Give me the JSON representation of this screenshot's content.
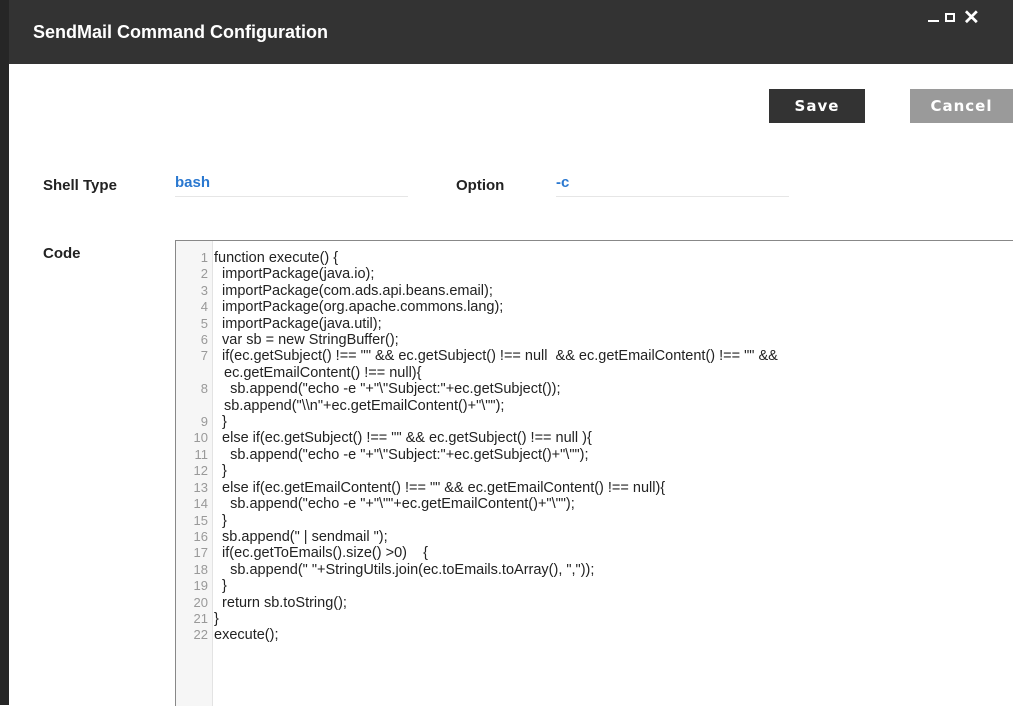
{
  "window": {
    "title": "SendMail Command Configuration"
  },
  "buttons": {
    "save": "Save",
    "cancel": "Cancel"
  },
  "form": {
    "shell_type_label": "Shell Type",
    "shell_type_value": "bash",
    "option_label": "Option",
    "option_value": "-c",
    "code_label": "Code"
  },
  "code": [
    {
      "n": "1",
      "t": "function execute() {"
    },
    {
      "n": "2",
      "t": "  importPackage(java.io);"
    },
    {
      "n": "3",
      "t": "  importPackage(com.ads.api.beans.email);"
    },
    {
      "n": "4",
      "t": "  importPackage(org.apache.commons.lang);"
    },
    {
      "n": "5",
      "t": "  importPackage(java.util);"
    },
    {
      "n": "6",
      "t": "  var sb = new StringBuffer();"
    },
    {
      "n": "7",
      "t": "  if(ec.getSubject() !== \"\" && ec.getSubject() !== null  && ec.getEmailContent() !== \"\" &&"
    },
    {
      "n": "",
      "t": "ec.getEmailContent() !== null){"
    },
    {
      "n": "8",
      "t": "    sb.append(\"echo -e \"+\"\\\"Subject:\"+ec.getSubject());"
    },
    {
      "n": "",
      "t": "sb.append(\"\\\\n\"+ec.getEmailContent()+\"\\\"\");"
    },
    {
      "n": "9",
      "t": "  }"
    },
    {
      "n": "10",
      "t": "  else if(ec.getSubject() !== \"\" && ec.getSubject() !== null ){"
    },
    {
      "n": "11",
      "t": "    sb.append(\"echo -e \"+\"\\\"Subject:\"+ec.getSubject()+\"\\\"\");"
    },
    {
      "n": "12",
      "t": "  }"
    },
    {
      "n": "13",
      "t": "  else if(ec.getEmailContent() !== \"\" && ec.getEmailContent() !== null){"
    },
    {
      "n": "14",
      "t": "    sb.append(\"echo -e \"+\"\\\"\"+ec.getEmailContent()+\"\\\"\");"
    },
    {
      "n": "15",
      "t": "  }"
    },
    {
      "n": "16",
      "t": "  sb.append(\" | sendmail \");"
    },
    {
      "n": "17",
      "t": "  if(ec.getToEmails().size() >0)    {"
    },
    {
      "n": "18",
      "t": "    sb.append(\" \"+StringUtils.join(ec.toEmails.toArray(), \",\"));"
    },
    {
      "n": "19",
      "t": "  }"
    },
    {
      "n": "20",
      "t": "  return sb.toString();"
    },
    {
      "n": "21",
      "t": "}"
    },
    {
      "n": "22",
      "t": "execute();"
    }
  ],
  "colors": {
    "titlebar": "#333333",
    "save_button": "#333333",
    "cancel_button": "#9a9a9a",
    "field_value": "#2a78d0"
  }
}
